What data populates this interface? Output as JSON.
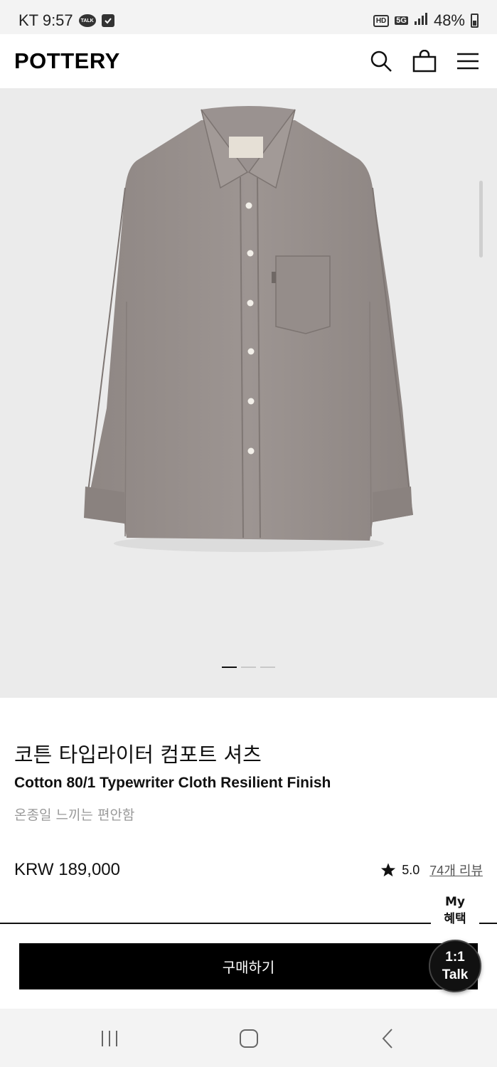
{
  "status_bar": {
    "carrier_time": "KT 9:57",
    "talk_icon_text": "TALK",
    "hd": "HD",
    "network": "5G",
    "battery": "48%"
  },
  "header": {
    "logo": "POTTERY",
    "icons": [
      "search-icon",
      "shopping-bag-icon",
      "menu-icon"
    ]
  },
  "gallery": {
    "image_subject": "grey long-sleeve button-up shirt",
    "background_color": "#ebebeb",
    "slide_count": 3,
    "active_slide": 1
  },
  "product": {
    "title_kr": "코튼 타입라이터 컴포트 셔츠",
    "title_en": "Cotton 80/1 Typewriter Cloth Resilient Finish",
    "subtitle": "온종일 느끼는 편안함",
    "price": "KRW 189,000",
    "rating": "5.0",
    "reviews": "74개 리뷰"
  },
  "actions": {
    "my_benefit_line1": "My",
    "my_benefit_line2": "혜택",
    "buy_label": "구매하기",
    "talk_line1": "1:1",
    "talk_line2": "Talk"
  },
  "nav": {
    "icons": [
      "recent-apps-icon",
      "home-icon",
      "back-icon"
    ]
  },
  "colors": {
    "accent": "#000000",
    "muted_text": "#9a9a9a",
    "status_bg": "#f3f3f3"
  }
}
